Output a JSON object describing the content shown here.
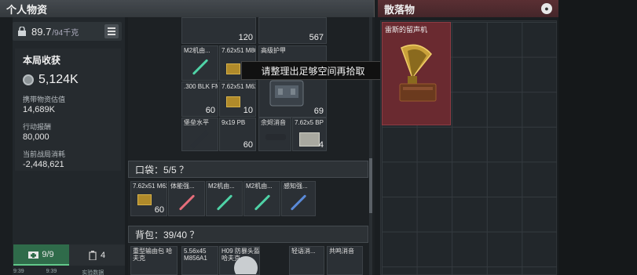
{
  "header": {
    "left_title": "个人物资",
    "right_title": "散落物"
  },
  "weight": {
    "value": "89.7",
    "max": "/94千克"
  },
  "stats": {
    "title": "本局收获",
    "total": "5,124K",
    "rows": [
      {
        "label": "携带物资估值",
        "value": "14,689K"
      },
      {
        "label": "行动报酬",
        "value": "80,000"
      },
      {
        "label": "当前战局消耗",
        "value": "-2,448,621"
      }
    ]
  },
  "tabs": [
    {
      "label": "9/9",
      "active": true
    },
    {
      "label": "4",
      "active": false
    }
  ],
  "bottom_row": [
    "9:39",
    "9:39",
    "实验数据"
  ],
  "top_counts": {
    "left": "120",
    "right": "567"
  },
  "items": [
    {
      "name": "M2机由...",
      "count": ""
    },
    {
      "name": "7.62x51 M80",
      "count": "60"
    },
    {
      "name": "高级护甲",
      "count": "69"
    },
    {
      "name": ".300 BLK FMJ",
      "count": "60"
    },
    {
      "name": "7.62x51 M62",
      "count": "10"
    },
    {
      "name": "堡垒水平",
      "count": ""
    },
    {
      "name": "9x19 PB",
      "count": "60"
    },
    {
      "name": "余烬消音",
      "count": ""
    },
    {
      "name": "7.62x5 BP",
      "count": "4"
    }
  ],
  "tooltip": "请整理出足够空间再拾取",
  "pockets": {
    "label": "口袋：5/5 ？",
    "items": [
      {
        "name": "7.62x51 M62",
        "count": "60"
      },
      {
        "name": "体能强...",
        "count": ""
      },
      {
        "name": "M2机由...",
        "count": ""
      },
      {
        "name": "M2机由...",
        "count": ""
      },
      {
        "name": "感知强...",
        "count": ""
      }
    ]
  },
  "backpack": {
    "label": "背包：39/40 ？",
    "items": [
      {
        "name": "重型输由包 哈夫克",
        "count": ""
      },
      {
        "name": "5.56x45 M856A1",
        "count": ""
      },
      {
        "name": "H09 防暴头盔 哈夫克",
        "count": ""
      },
      {
        "name": "轻语消...",
        "count": ""
      },
      {
        "name": "共鸣消音",
        "count": ""
      }
    ]
  },
  "loot": {
    "name": "雷斯的留声机"
  },
  "colors": {
    "accent_green": "#2f6b4a",
    "loot_red": "#6a2a30",
    "ammo": "#b08a2a"
  }
}
